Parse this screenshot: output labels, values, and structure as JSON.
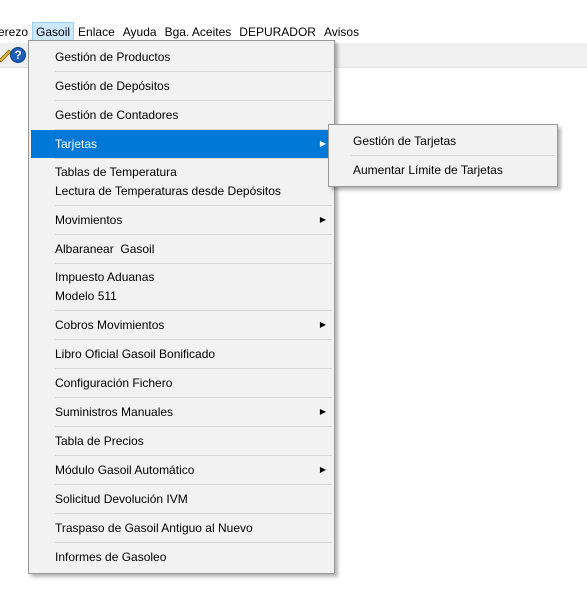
{
  "menubar": {
    "items": [
      "erezo",
      "Gasoil",
      "Enlace",
      "Ayuda",
      "Bga. Aceites",
      "DEPURADOR",
      "Avisos"
    ]
  },
  "toolbar": {
    "icons": [
      "pencil-icon",
      "help-icon"
    ],
    "help_glyph": "?"
  },
  "gasoil_menu": {
    "items": [
      {
        "lines": [
          "Gestión de Productos"
        ],
        "submenu": false
      },
      {
        "lines": [
          "Gestión de Depósitos"
        ],
        "submenu": false
      },
      {
        "lines": [
          "Gestión de Contadores"
        ],
        "submenu": false
      },
      {
        "lines": [
          "Tarjetas"
        ],
        "submenu": true,
        "highlighted": true
      },
      {
        "lines": [
          "Tablas de Temperatura",
          "Lectura de Temperaturas desde Depósitos"
        ],
        "submenu": false
      },
      {
        "lines": [
          "Movimientos"
        ],
        "submenu": true
      },
      {
        "lines": [
          "Albaranear  Gasoil"
        ],
        "submenu": false
      },
      {
        "lines": [
          "Impuesto Aduanas",
          "Modelo 511"
        ],
        "submenu": false
      },
      {
        "lines": [
          "Cobros Movimientos"
        ],
        "submenu": true
      },
      {
        "lines": [
          "Libro Oficial Gasoil Bonificado"
        ],
        "submenu": false
      },
      {
        "lines": [
          "Configuración Fichero"
        ],
        "submenu": false
      },
      {
        "lines": [
          "Suministros Manuales"
        ],
        "submenu": true
      },
      {
        "lines": [
          "Tabla de Precios"
        ],
        "submenu": false
      },
      {
        "lines": [
          "Módulo Gasoil Automático"
        ],
        "submenu": true
      },
      {
        "lines": [
          "Solicitud Devolución IVM"
        ],
        "submenu": false
      },
      {
        "lines": [
          "Traspaso de Gasoil Antiguo al Nuevo"
        ],
        "submenu": false
      },
      {
        "lines": [
          "Informes de Gasoleo"
        ],
        "submenu": false
      }
    ]
  },
  "tarjetas_submenu": {
    "items": [
      "Gestión de Tarjetas",
      "Aumentar Límite de Tarjetas"
    ]
  },
  "colors": {
    "highlight": "#0078d7",
    "menu_bg": "#f2f2f2",
    "active_menubar": "#cce8ff"
  }
}
